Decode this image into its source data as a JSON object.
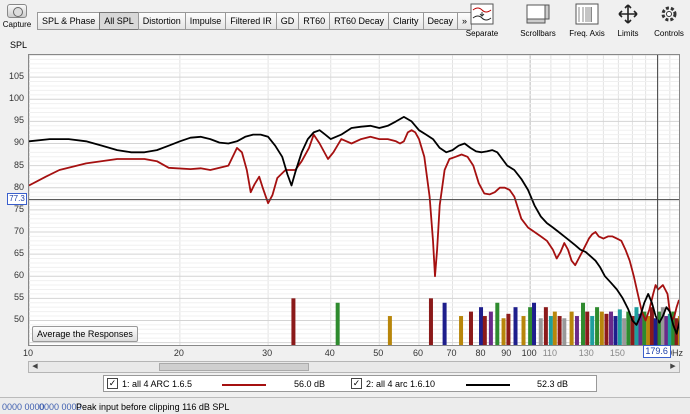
{
  "toolbar": {
    "capture_label": "Capture",
    "tabs": [
      {
        "label": "SPL & Phase",
        "active": false
      },
      {
        "label": "All SPL",
        "active": true
      },
      {
        "label": "Distortion",
        "active": false
      },
      {
        "label": "Impulse",
        "active": false
      },
      {
        "label": "Filtered IR",
        "active": false
      },
      {
        "label": "GD",
        "active": false
      },
      {
        "label": "RT60",
        "active": false
      },
      {
        "label": "RT60 Decay",
        "active": false
      },
      {
        "label": "Clarity",
        "active": false
      },
      {
        "label": "Decay",
        "active": false
      },
      {
        "label": "»",
        "active": false
      }
    ],
    "buttons": [
      {
        "label": "Separate",
        "icon": "separate-icon"
      },
      {
        "label": "Scrollbars",
        "icon": "scrollbars-icon"
      },
      {
        "label": "Freq. Axis",
        "icon": "freq-axis-icon"
      },
      {
        "label": "Limits",
        "icon": "limits-icon"
      },
      {
        "label": "Controls",
        "icon": "controls-icon"
      }
    ]
  },
  "chart_data": {
    "type": "line",
    "ylabel": "SPL",
    "xscale": "log",
    "xlim": [
      10,
      200
    ],
    "ylim": [
      44,
      110
    ],
    "yticks": [
      50,
      55,
      60,
      65,
      70,
      75,
      80,
      85,
      90,
      95,
      100,
      105
    ],
    "xticks": [
      {
        "v": 10,
        "label": "10",
        "minor": false
      },
      {
        "v": 20,
        "label": "20",
        "minor": false
      },
      {
        "v": 30,
        "label": "30",
        "minor": false
      },
      {
        "v": 40,
        "label": "40",
        "minor": false
      },
      {
        "v": 50,
        "label": "50",
        "minor": false
      },
      {
        "v": 60,
        "label": "60",
        "minor": false
      },
      {
        "v": 70,
        "label": "70",
        "minor": false
      },
      {
        "v": 80,
        "label": "80",
        "minor": false
      },
      {
        "v": 90,
        "label": "90",
        "minor": false
      },
      {
        "v": 100,
        "label": "100",
        "minor": false
      },
      {
        "v": 110,
        "label": "110",
        "minor": true
      },
      {
        "v": 130,
        "label": "130",
        "minor": true
      },
      {
        "v": 150,
        "label": "150",
        "minor": true
      },
      {
        "v": 200,
        "label": "200Hz",
        "minor": false
      }
    ],
    "cursor": {
      "y": 77.3,
      "y_label": "77.3",
      "x": 179.6,
      "x_label": "179.6"
    },
    "series": [
      {
        "name": "1: all 4 ARC 1.6.5",
        "color": "#a51010",
        "points": [
          [
            10,
            80.5
          ],
          [
            10.8,
            82.5
          ],
          [
            11.5,
            84
          ],
          [
            13,
            85.5
          ],
          [
            15,
            86.5
          ],
          [
            17,
            86.5
          ],
          [
            18,
            86
          ],
          [
            19,
            84.5
          ],
          [
            21,
            84.2
          ],
          [
            22,
            84.4
          ],
          [
            23,
            84
          ],
          [
            25,
            85
          ],
          [
            26,
            89
          ],
          [
            26.6,
            88
          ],
          [
            27.2,
            84
          ],
          [
            27.7,
            79
          ],
          [
            28.2,
            80.8
          ],
          [
            28.8,
            82.5
          ],
          [
            29.3,
            79.8
          ],
          [
            30,
            76.5
          ],
          [
            30.6,
            78.3
          ],
          [
            31.3,
            82.2
          ],
          [
            32.5,
            84
          ],
          [
            34,
            84
          ],
          [
            35,
            86
          ],
          [
            36.2,
            89
          ],
          [
            37,
            92
          ],
          [
            38,
            90
          ],
          [
            39.5,
            86.5
          ],
          [
            40.5,
            88
          ],
          [
            42,
            91
          ],
          [
            44,
            90
          ],
          [
            46,
            91
          ],
          [
            48,
            91.5
          ],
          [
            50,
            91
          ],
          [
            52,
            91
          ],
          [
            54,
            90.5
          ],
          [
            55,
            90
          ],
          [
            56,
            90.5
          ],
          [
            57,
            92.5
          ],
          [
            58,
            93
          ],
          [
            59,
            92.5
          ],
          [
            60,
            91
          ],
          [
            61.5,
            87
          ],
          [
            63,
            78
          ],
          [
            64,
            68
          ],
          [
            64.6,
            60
          ],
          [
            65.2,
            66
          ],
          [
            66,
            76
          ],
          [
            67.5,
            84
          ],
          [
            69,
            86.5
          ],
          [
            71,
            87
          ],
          [
            73,
            87.5
          ],
          [
            75,
            87
          ],
          [
            77,
            85
          ],
          [
            79,
            81
          ],
          [
            81,
            78.7
          ],
          [
            83,
            78.5
          ],
          [
            85,
            79
          ],
          [
            87,
            80
          ],
          [
            89,
            80
          ],
          [
            91,
            79.5
          ],
          [
            93,
            78
          ],
          [
            96,
            73
          ],
          [
            99,
            71
          ],
          [
            102,
            70
          ],
          [
            105,
            69
          ],
          [
            108,
            68
          ],
          [
            111,
            66
          ],
          [
            113,
            64
          ],
          [
            115,
            65.5
          ],
          [
            117,
            67.5
          ],
          [
            119,
            66
          ],
          [
            121,
            63.5
          ],
          [
            123,
            62.5
          ],
          [
            125,
            64
          ],
          [
            127,
            65.5
          ],
          [
            129,
            67
          ],
          [
            131,
            68.5
          ],
          [
            133,
            69.5
          ],
          [
            135,
            70
          ],
          [
            137,
            69
          ],
          [
            140,
            68.5
          ],
          [
            143,
            69
          ],
          [
            146,
            69
          ],
          [
            149,
            68.5
          ],
          [
            152,
            68
          ],
          [
            155,
            66
          ],
          [
            158,
            63.5
          ],
          [
            161,
            60
          ],
          [
            164,
            56
          ],
          [
            167,
            52
          ],
          [
            170,
            50
          ],
          [
            173,
            52.5
          ],
          [
            176,
            56
          ],
          [
            178,
            58
          ],
          [
            180,
            57
          ],
          [
            182,
            57.5
          ],
          [
            184,
            58
          ],
          [
            186,
            57
          ],
          [
            188,
            56
          ],
          [
            190,
            52
          ],
          [
            192,
            50
          ],
          [
            194,
            51
          ],
          [
            196,
            53
          ],
          [
            198,
            54.5
          ],
          [
            200,
            54
          ]
        ]
      },
      {
        "name": "2: all 4 arc 1.6.10",
        "color": "#000000",
        "points": [
          [
            10,
            90.5
          ],
          [
            11,
            91
          ],
          [
            12,
            91
          ],
          [
            13,
            90.5
          ],
          [
            14,
            89.5
          ],
          [
            15,
            88.5
          ],
          [
            16,
            88
          ],
          [
            17,
            88
          ],
          [
            18,
            88.5
          ],
          [
            19,
            89.5
          ],
          [
            20,
            90.5
          ],
          [
            21,
            91.3
          ],
          [
            22,
            91.5
          ],
          [
            23,
            91
          ],
          [
            24,
            90.2
          ],
          [
            25,
            90
          ],
          [
            26,
            90.5
          ],
          [
            27,
            91.5
          ],
          [
            28,
            92
          ],
          [
            29,
            92
          ],
          [
            30,
            91.5
          ],
          [
            31,
            89.5
          ],
          [
            32,
            87
          ],
          [
            32.8,
            83
          ],
          [
            33.4,
            80.5
          ],
          [
            34,
            83.5
          ],
          [
            35,
            88
          ],
          [
            36,
            91
          ],
          [
            37,
            92.5
          ],
          [
            38,
            93
          ],
          [
            39,
            92
          ],
          [
            40,
            91
          ],
          [
            42,
            92
          ],
          [
            44,
            93.5
          ],
          [
            46,
            93.8
          ],
          [
            48,
            94
          ],
          [
            50,
            93.5
          ],
          [
            52,
            94
          ],
          [
            54,
            95
          ],
          [
            56,
            96
          ],
          [
            58,
            95
          ],
          [
            60,
            93
          ],
          [
            62,
            92
          ],
          [
            64,
            91
          ],
          [
            66,
            89
          ],
          [
            68,
            88
          ],
          [
            70,
            88.5
          ],
          [
            72,
            89.5
          ],
          [
            74,
            90
          ],
          [
            76,
            89
          ],
          [
            78,
            88.2
          ],
          [
            80,
            88
          ],
          [
            82,
            88.2
          ],
          [
            84,
            88.5
          ],
          [
            86,
            88
          ],
          [
            88,
            86.5
          ],
          [
            90,
            85
          ],
          [
            93,
            84
          ],
          [
            96,
            82
          ],
          [
            99,
            79.5
          ],
          [
            102,
            76
          ],
          [
            105,
            73.5
          ],
          [
            108,
            72
          ],
          [
            111,
            71
          ],
          [
            114,
            70
          ],
          [
            117,
            69
          ],
          [
            120,
            68
          ],
          [
            123,
            67
          ],
          [
            126,
            66
          ],
          [
            129,
            65.5
          ],
          [
            132,
            64.5
          ],
          [
            135,
            63.5
          ],
          [
            138,
            62
          ],
          [
            141,
            60
          ],
          [
            145,
            58.5
          ],
          [
            149,
            57
          ],
          [
            153,
            55
          ],
          [
            157,
            52.5
          ],
          [
            160,
            50
          ],
          [
            163,
            49
          ],
          [
            166,
            51
          ],
          [
            169,
            54
          ],
          [
            172,
            56
          ],
          [
            175,
            54
          ],
          [
            178,
            51
          ],
          [
            181,
            49.5
          ],
          [
            184,
            51
          ],
          [
            187,
            53
          ],
          [
            190,
            52
          ],
          [
            193,
            49
          ],
          [
            196,
            47
          ],
          [
            198,
            49
          ],
          [
            200,
            52
          ]
        ]
      }
    ],
    "bars": [
      {
        "f": 33.7,
        "h": 55,
        "c": "#8b1a1a"
      },
      {
        "f": 41.3,
        "h": 54,
        "c": "#2e8b2e"
      },
      {
        "f": 52.5,
        "h": 51,
        "c": "#b8860b"
      },
      {
        "f": 63.4,
        "h": 55,
        "c": "#8b1a1a"
      },
      {
        "f": 67.5,
        "h": 54,
        "c": "#1e1e8c"
      },
      {
        "f": 72.8,
        "h": 51,
        "c": "#b8860b"
      },
      {
        "f": 76.2,
        "h": 52,
        "c": "#8b1a1a"
      },
      {
        "f": 79.8,
        "h": 53,
        "c": "#1e1e8c"
      },
      {
        "f": 81.2,
        "h": 51,
        "c": "#8b1a1a"
      },
      {
        "f": 83.5,
        "h": 52,
        "c": "#6a2a8a"
      },
      {
        "f": 86,
        "h": 54,
        "c": "#2e8b2e"
      },
      {
        "f": 88.5,
        "h": 50.5,
        "c": "#b8860b"
      },
      {
        "f": 90.5,
        "h": 51.5,
        "c": "#8b1a1a"
      },
      {
        "f": 93.5,
        "h": 53,
        "c": "#1e1e8c"
      },
      {
        "f": 97,
        "h": 51,
        "c": "#b8860b"
      },
      {
        "f": 100,
        "h": 53,
        "c": "#2e8b2e"
      },
      {
        "f": 101.8,
        "h": 54,
        "c": "#1e1e8c"
      },
      {
        "f": 105,
        "h": 50.5,
        "c": "#999999"
      },
      {
        "f": 107.5,
        "h": 53,
        "c": "#8b1a1a"
      },
      {
        "f": 110,
        "h": 51,
        "c": "#1e9e9e"
      },
      {
        "f": 112,
        "h": 52,
        "c": "#b8860b"
      },
      {
        "f": 114.5,
        "h": 51,
        "c": "#8b1a1a"
      },
      {
        "f": 117,
        "h": 50.5,
        "c": "#999999"
      },
      {
        "f": 121,
        "h": 52,
        "c": "#b8860b"
      },
      {
        "f": 124,
        "h": 51,
        "c": "#6a2a8a"
      },
      {
        "f": 127.5,
        "h": 54,
        "c": "#2e8b2e"
      },
      {
        "f": 130,
        "h": 52,
        "c": "#8b1a1a"
      },
      {
        "f": 133,
        "h": 51,
        "c": "#1e9e9e"
      },
      {
        "f": 136,
        "h": 53,
        "c": "#2e8b2e"
      },
      {
        "f": 139,
        "h": 52,
        "c": "#b8860b"
      },
      {
        "f": 142,
        "h": 51.5,
        "c": "#8b1a1a"
      },
      {
        "f": 145,
        "h": 52,
        "c": "#6a2a8a"
      },
      {
        "f": 148,
        "h": 51,
        "c": "#1e1e8c"
      },
      {
        "f": 151,
        "h": 52.5,
        "c": "#1e9e9e"
      },
      {
        "f": 154,
        "h": 50.5,
        "c": "#999999"
      },
      {
        "f": 157,
        "h": 52,
        "c": "#2e8b2e"
      },
      {
        "f": 160,
        "h": 51,
        "c": "#8b1a1a"
      },
      {
        "f": 163,
        "h": 53,
        "c": "#1e9e9e"
      },
      {
        "f": 166,
        "h": 51.5,
        "c": "#6a2a8a"
      },
      {
        "f": 169,
        "h": 52,
        "c": "#2e8b2e"
      },
      {
        "f": 172,
        "h": 51,
        "c": "#b8860b"
      },
      {
        "f": 175,
        "h": 53,
        "c": "#8b1a1a"
      },
      {
        "f": 178,
        "h": 50.5,
        "c": "#1e1e8c"
      },
      {
        "f": 181,
        "h": 52,
        "c": "#2e8b2e"
      },
      {
        "f": 184,
        "h": 53,
        "c": "#999999"
      },
      {
        "f": 187,
        "h": 51,
        "c": "#6a2a8a"
      },
      {
        "f": 190,
        "h": 51.5,
        "c": "#1e9e9e"
      },
      {
        "f": 193,
        "h": 52,
        "c": "#2e8b2e"
      },
      {
        "f": 196,
        "h": 50.5,
        "c": "#8b1a1a"
      },
      {
        "f": 199,
        "h": 51,
        "c": "#b8860b"
      }
    ]
  },
  "plot": {
    "average_button_label": "Average the Responses",
    "y_axis_label": "SPL"
  },
  "legend": {
    "items": [
      {
        "checked": true,
        "label": "1: all 4 ARC 1.6.5",
        "color": "#a51010",
        "value": "56.0 dB"
      },
      {
        "checked": true,
        "label": "2: all 4 arc 1.6.10",
        "color": "#000000",
        "value": "52.3 dB"
      }
    ]
  },
  "status_bar": {
    "meter_left": "0000 0000",
    "meter_right": "0000 0000",
    "message": "Peak input before clipping 116 dB SPL"
  }
}
